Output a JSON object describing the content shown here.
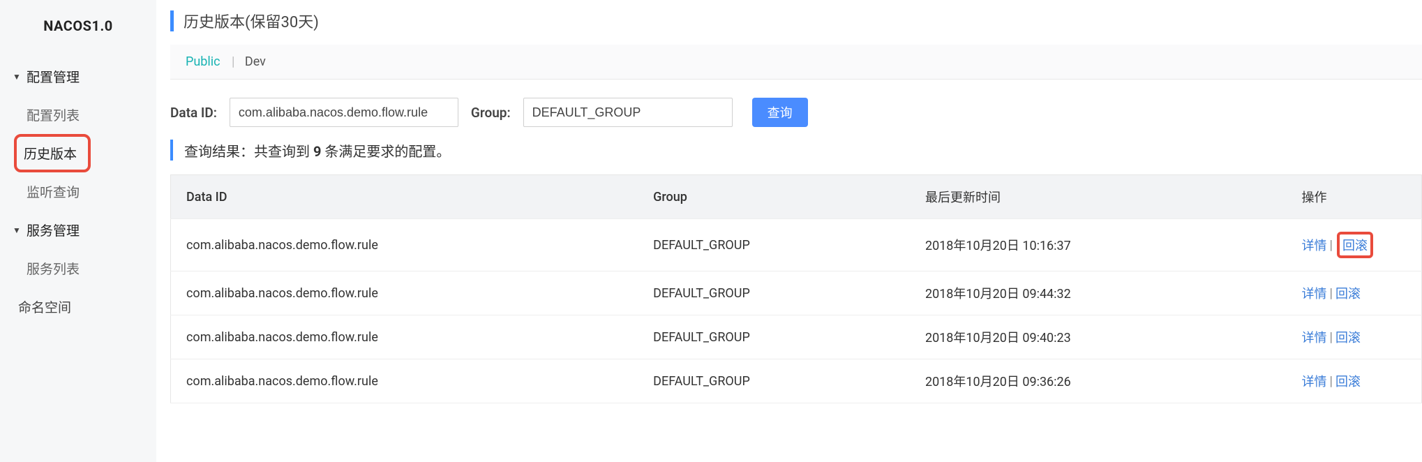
{
  "app": {
    "logo": "NACOS1.0"
  },
  "sidebar": {
    "groups": [
      {
        "label": "配置管理",
        "items": [
          {
            "label": "配置列表",
            "active": false
          },
          {
            "label": "历史版本",
            "active": true,
            "highlight": true
          },
          {
            "label": "监听查询",
            "active": false
          }
        ]
      },
      {
        "label": "服务管理",
        "items": [
          {
            "label": "服务列表",
            "active": false
          }
        ]
      }
    ],
    "tail_item": {
      "label": "命名空间"
    }
  },
  "page": {
    "title": "历史版本(保留30天)",
    "tabs": [
      {
        "label": "Public",
        "active": true
      },
      {
        "label": "Dev",
        "active": false
      }
    ],
    "filters": {
      "dataid_label": "Data ID:",
      "dataid_value": "com.alibaba.nacos.demo.flow.rule",
      "group_label": "Group:",
      "group_value": "DEFAULT_GROUP",
      "search_label": "查询"
    },
    "result": {
      "prefix": "查询结果：共查询到 ",
      "count": "9",
      "suffix": " 条满足要求的配置。"
    },
    "table": {
      "headers": {
        "dataid": "Data ID",
        "group": "Group",
        "time": "最后更新时间",
        "ops": "操作"
      },
      "ops_labels": {
        "detail": "详情",
        "rollback": "回滚"
      },
      "rows": [
        {
          "dataid": "com.alibaba.nacos.demo.flow.rule",
          "group": "DEFAULT_GROUP",
          "time": "2018年10月20日 10:16:37",
          "highlight_rollback": true
        },
        {
          "dataid": "com.alibaba.nacos.demo.flow.rule",
          "group": "DEFAULT_GROUP",
          "time": "2018年10月20日 09:44:32",
          "highlight_rollback": false
        },
        {
          "dataid": "com.alibaba.nacos.demo.flow.rule",
          "group": "DEFAULT_GROUP",
          "time": "2018年10月20日 09:40:23",
          "highlight_rollback": false
        },
        {
          "dataid": "com.alibaba.nacos.demo.flow.rule",
          "group": "DEFAULT_GROUP",
          "time": "2018年10月20日 09:36:26",
          "highlight_rollback": false
        }
      ]
    }
  }
}
